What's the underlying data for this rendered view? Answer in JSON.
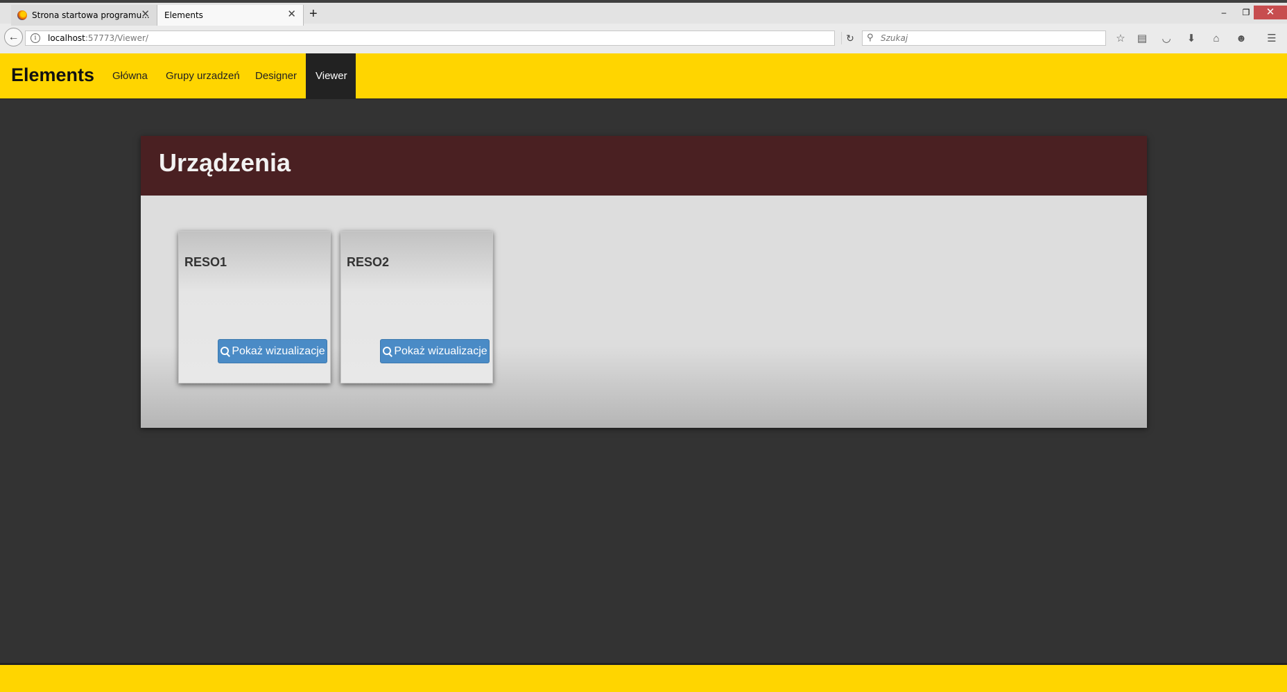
{
  "browser": {
    "tabs": [
      {
        "title": "Strona startowa programu...",
        "active": false
      },
      {
        "title": "Elements",
        "active": true
      }
    ],
    "new_tab_icon": "plus-icon",
    "window_controls": {
      "minimize": "–",
      "maximize": "❐",
      "close": "✕"
    },
    "url": {
      "host": "localhost",
      "rest": ":57773/Viewer/"
    },
    "search": {
      "placeholder": "Szukaj"
    },
    "toolbar_icons": [
      "bookmark-star-icon",
      "reading-list-icon",
      "pocket-icon",
      "download-icon",
      "home-icon",
      "emoji-icon",
      "menu-icon"
    ]
  },
  "site": {
    "brand": "Elements",
    "nav": [
      {
        "label": "Główna",
        "active": false
      },
      {
        "label": "Grupy urzadzeń",
        "active": false
      },
      {
        "label": "Designer",
        "active": false
      },
      {
        "label": "Viewer",
        "active": true
      }
    ],
    "colors": {
      "header": "#ffd500",
      "panel_header": "#4a2022",
      "button": "#4a8bc6",
      "page_bg": "#333333"
    }
  },
  "panel": {
    "title": "Urządzenia",
    "devices": [
      {
        "name": "RESO1",
        "button_label": "Pokaż wizualizacje"
      },
      {
        "name": "RESO2",
        "button_label": "Pokaż wizualizacje"
      }
    ]
  }
}
